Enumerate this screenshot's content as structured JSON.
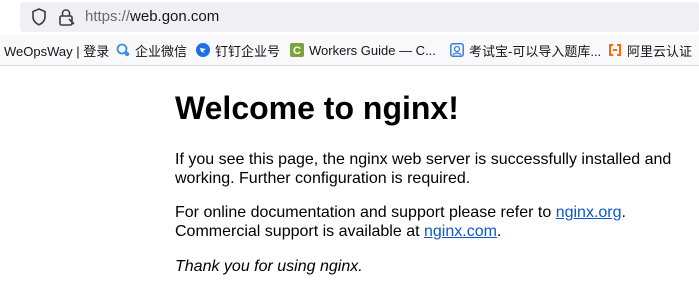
{
  "browser": {
    "url_scheme": "https://",
    "url_host": "web.gon.com",
    "icons": {
      "shield": "shield-icon",
      "lock": "lock-icon"
    }
  },
  "bookmarks": [
    {
      "label": "WeOpsWay | 登录",
      "icon": ""
    },
    {
      "label": "企业微信",
      "icon": "wecom-icon",
      "color": "#3a8ee6"
    },
    {
      "label": "钉钉企业号",
      "icon": "dingtalk-icon",
      "color": "#1e6fe8"
    },
    {
      "label": "Workers Guide — C...",
      "icon": "workers-guide-icon",
      "color": "#7aa33a"
    },
    {
      "label": "考试宝-可以导入题库...",
      "icon": "kaoshibao-icon",
      "color": "#3b7ed6"
    },
    {
      "label": "阿里云认证",
      "icon": "aliyun-icon",
      "color": "#ff6a00"
    }
  ],
  "page": {
    "title": "Welcome to nginx!",
    "para1": "If you see this page, the nginx web server is successfully installed and working. Further configuration is required.",
    "para2_prefix": "For online documentation and support please refer to ",
    "link1": "nginx.org",
    "para2_mid": ".",
    "para2_line2_prefix": "Commercial support is available at ",
    "link2": "nginx.com",
    "para2_suffix": ".",
    "para3": "Thank you for using nginx."
  },
  "colors": {
    "link": "#0b57d0",
    "url_field_bg": "#f0f0f4",
    "bookmarks_bg": "#f9f9fb"
  }
}
